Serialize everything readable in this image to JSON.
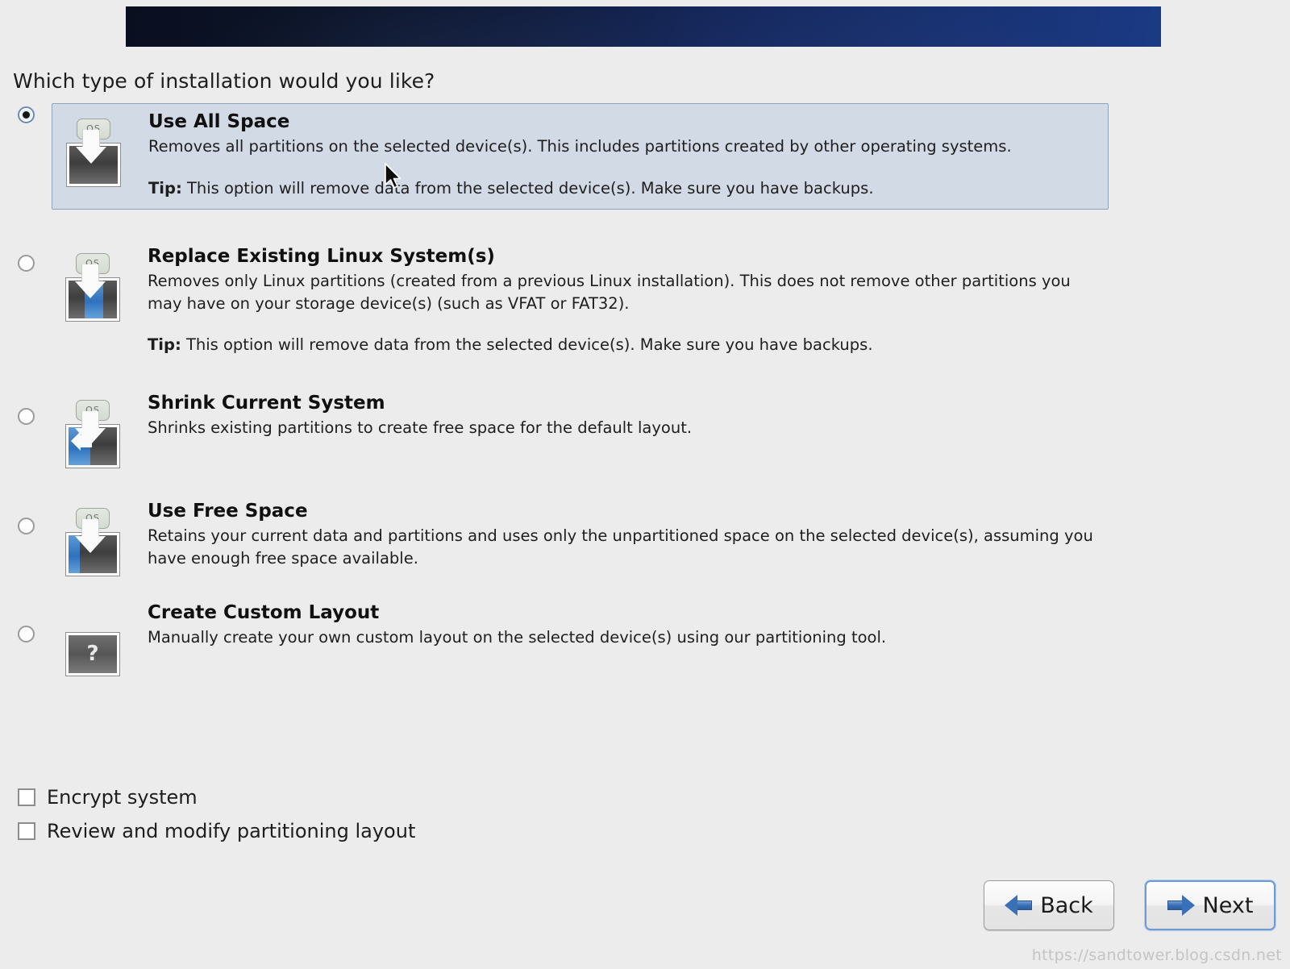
{
  "window": {
    "title": "Installation Type",
    "banner_gradient_from": "#0a0f20",
    "banner_gradient_to": "#1b3a85",
    "background": "#ececec"
  },
  "question": "Which type of installation would you like?",
  "options": [
    {
      "id": "use-all-space",
      "title": "Use All Space",
      "description": "Removes all partitions on the selected device(s).  This includes partitions created by other operating systems.",
      "tip_label": "Tip:",
      "tip_text": "This option will remove data from the selected device(s).  Make sure you have backups.",
      "selected": true,
      "icon": "disk-full-overwrite-icon"
    },
    {
      "id": "replace-existing-linux",
      "title": "Replace Existing Linux System(s)",
      "description": "Removes only Linux partitions (created from a previous Linux installation).  This does not remove other partitions you may have on your storage device(s) (such as VFAT or FAT32).",
      "tip_label": "Tip:",
      "tip_text": "This option will remove data from the selected device(s).  Make sure you have backups.",
      "selected": false,
      "icon": "disk-replace-linux-icon"
    },
    {
      "id": "shrink-current-system",
      "title": "Shrink Current System",
      "description": "Shrinks existing partitions to create free space for the default layout.",
      "tip_label": "",
      "tip_text": "",
      "selected": false,
      "icon": "disk-shrink-icon"
    },
    {
      "id": "use-free-space",
      "title": "Use Free Space",
      "description": "Retains your current data and partitions and uses only the unpartitioned space on the selected device(s), assuming you have enough free space available.",
      "tip_label": "",
      "tip_text": "",
      "selected": false,
      "icon": "disk-free-space-icon"
    },
    {
      "id": "create-custom-layout",
      "title": "Create Custom Layout",
      "description": "Manually create your own custom layout on the selected device(s) using our partitioning tool.",
      "tip_label": "",
      "tip_text": "",
      "selected": false,
      "icon": "disk-question-icon"
    }
  ],
  "icon_badge_text": "OS",
  "custom_layout_glyph": "?",
  "checkboxes": [
    {
      "id": "encrypt-system",
      "label": "Encrypt system",
      "checked": false
    },
    {
      "id": "review-modify-partitioning",
      "label": "Review and modify partitioning layout",
      "checked": false
    }
  ],
  "buttons": {
    "back": {
      "label": "Back",
      "icon": "arrow-left-icon",
      "focused": false
    },
    "next": {
      "label": "Next",
      "icon": "arrow-right-icon",
      "focused": true
    }
  },
  "watermark": "https://sandtower.blog.csdn.net",
  "colors": {
    "selected_row_bg": "#d2dae6",
    "selected_row_border": "#8fa3bd",
    "accent_blue": "#3a70b5",
    "text": "#1d1d1d"
  }
}
